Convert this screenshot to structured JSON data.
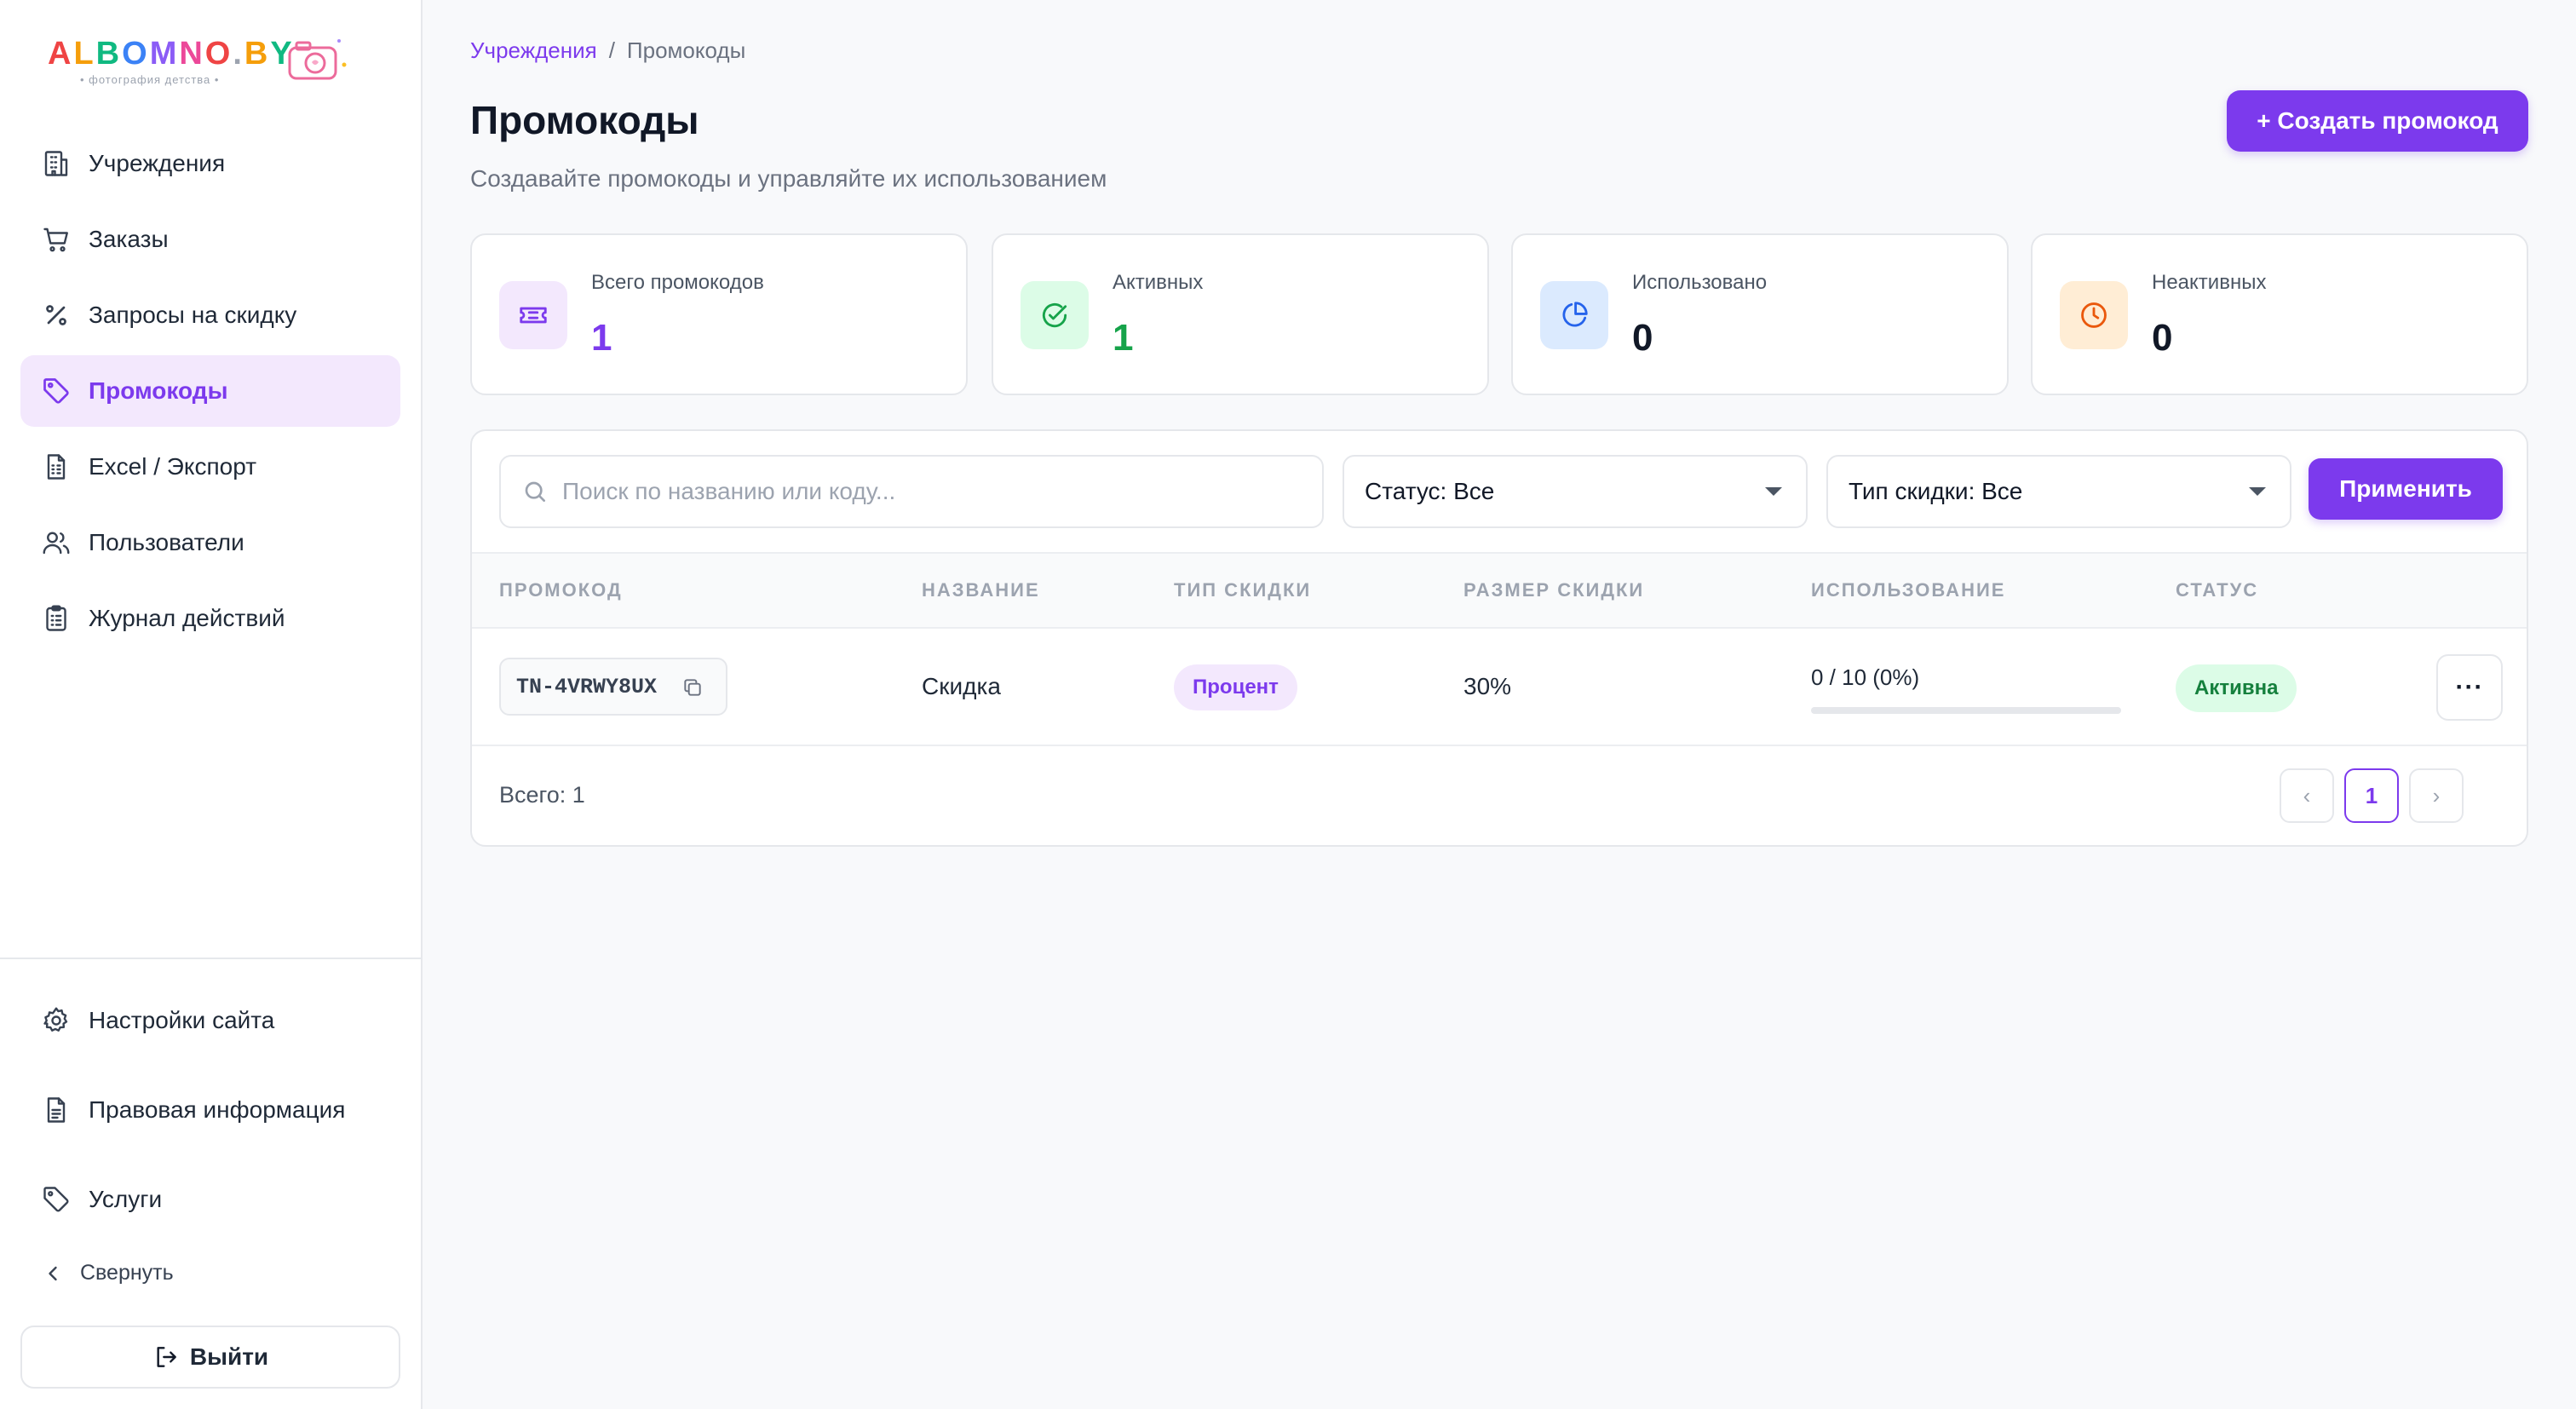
{
  "brand": {
    "logo_text": "ALBOMNO.BY",
    "tagline": "• фотография детства •",
    "logo_colors": [
      "#ef4444",
      "#f59e0b",
      "#10b981",
      "#3b82f6",
      "#8b5cf6",
      "#ec4899"
    ]
  },
  "sidebar": {
    "items": [
      {
        "label": "Учреждения",
        "icon": "building-icon"
      },
      {
        "label": "Заказы",
        "icon": "cart-icon"
      },
      {
        "label": "Запросы на скидку",
        "icon": "percent-icon"
      },
      {
        "label": "Промокоды",
        "icon": "tag-icon",
        "active": true
      },
      {
        "label": "Excel / Экспорт",
        "icon": "spreadsheet-icon"
      },
      {
        "label": "Пользователи",
        "icon": "users-icon"
      },
      {
        "label": "Журнал действий",
        "icon": "clipboard-icon"
      }
    ],
    "bottom_items": [
      {
        "label": "Настройки сайта",
        "icon": "gear-icon"
      },
      {
        "label": "Правовая информация",
        "icon": "document-icon"
      },
      {
        "label": "Услуги",
        "icon": "tag-icon"
      }
    ],
    "collapse_label": "Свернуть",
    "logout_label": "Выйти"
  },
  "breadcrumb": {
    "parent": "Учреждения",
    "separator": "/",
    "current": "Промокоды"
  },
  "header": {
    "title": "Промокоды",
    "subtitle": "Создавайте промокоды и управляйте их использованием",
    "create_button": "+ Создать промокод"
  },
  "stats": [
    {
      "label": "Всего промокодов",
      "value": "1",
      "icon": "ticket-icon",
      "value_color": "#7c3aed",
      "icon_bg": "#f3e8fd",
      "icon_color": "#7c3aed"
    },
    {
      "label": "Активных",
      "value": "1",
      "icon": "check-circle-icon",
      "value_color": "#16a34a",
      "icon_bg": "#dcfce7",
      "icon_color": "#16a34a"
    },
    {
      "label": "Использовано",
      "value": "0",
      "icon": "pie-chart-icon",
      "value_color": "#111827",
      "icon_bg": "#dbeafe",
      "icon_color": "#2563eb"
    },
    {
      "label": "Неактивных",
      "value": "0",
      "icon": "clock-icon",
      "value_color": "#111827",
      "icon_bg": "#ffedd5",
      "icon_color": "#ea580c"
    }
  ],
  "filters": {
    "search_placeholder": "Поиск по названию или коду...",
    "search_value": "",
    "status_select": "Статус: Все",
    "type_select": "Тип скидки: Все",
    "apply_button": "Применить"
  },
  "table": {
    "columns": [
      "ПРОМОКОД",
      "НАЗВАНИЕ",
      "ТИП СКИДКИ",
      "РАЗМЕР СКИДКИ",
      "ИСПОЛЬЗОВАНИЕ",
      "СТАТУС"
    ],
    "rows": [
      {
        "code": "TN-4VRWY8UX",
        "name": "Скидка",
        "type": "Процент",
        "size": "30%",
        "usage": "0 / 10 (0%)",
        "usage_fraction": 0,
        "status": "Активна",
        "actions": "···"
      }
    ]
  },
  "footer": {
    "total": "Всего: 1",
    "prev": "‹",
    "page": "1",
    "next": "›"
  },
  "colors": {
    "accent": "#7c3aed",
    "success": "#16a34a",
    "background": "#f8f9fb"
  }
}
